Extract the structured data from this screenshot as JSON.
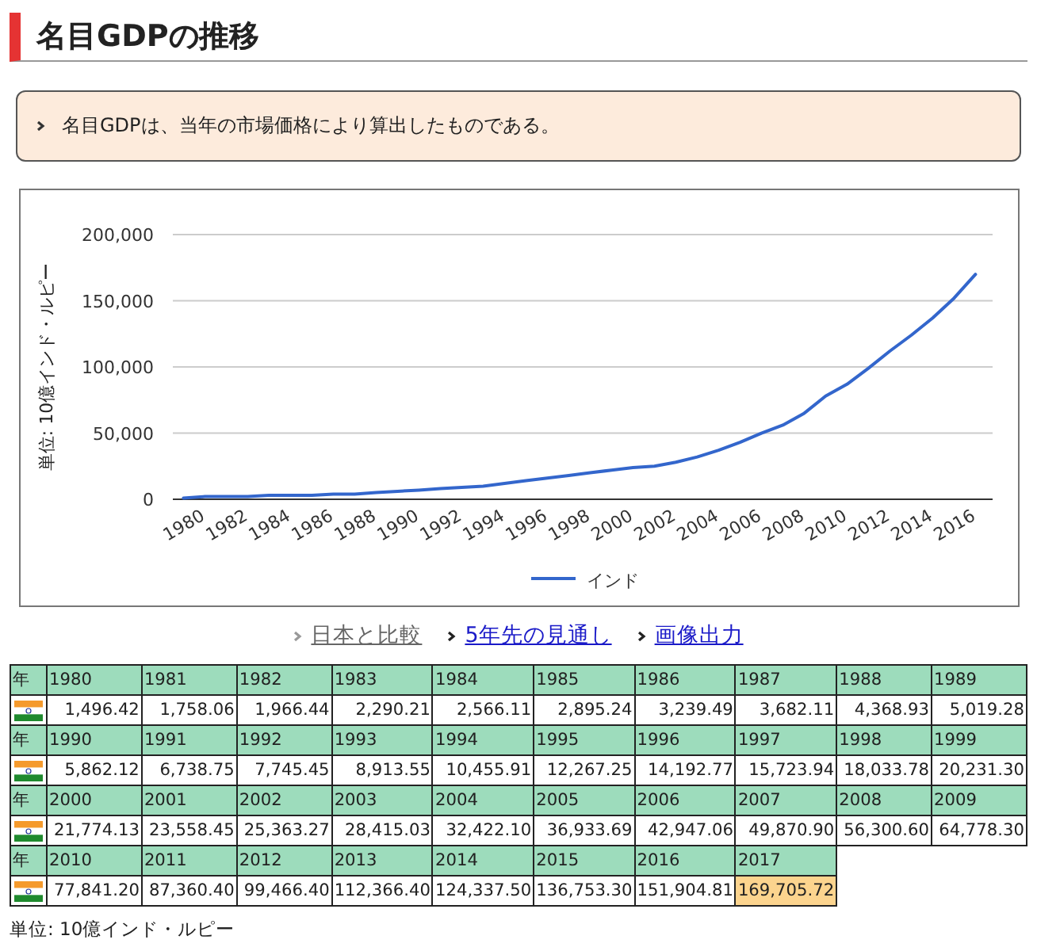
{
  "heading": "名目GDPの推移",
  "note": "名目GDPは、当年の市場価格により算出したものである。",
  "chart": {
    "chart_data": {
      "type": "line",
      "ylabel": "単位: 10億インド・ルピー",
      "x": [
        1980,
        1981,
        1982,
        1983,
        1984,
        1985,
        1986,
        1987,
        1988,
        1989,
        1990,
        1991,
        1992,
        1993,
        1994,
        1995,
        1996,
        1997,
        1998,
        1999,
        2000,
        2001,
        2002,
        2003,
        2004,
        2005,
        2006,
        2007,
        2008,
        2009,
        2010,
        2011,
        2012,
        2013,
        2014,
        2015,
        2016,
        2017
      ],
      "series": [
        {
          "name": "インド",
          "color": "#3366cc",
          "values": [
            1000,
            2000,
            2000,
            2000,
            3000,
            3000,
            3000,
            4000,
            4000,
            5000,
            6000,
            7000,
            8000,
            9000,
            10000,
            12000,
            14000,
            16000,
            18000,
            20000,
            22000,
            24000,
            25000,
            28000,
            32000,
            37000,
            43000,
            50000,
            56000,
            65000,
            78000,
            87000,
            99000,
            112000,
            124000,
            137000,
            152000,
            170000
          ]
        }
      ],
      "xlim": [
        1979.5,
        2017.8
      ],
      "ylim": [
        0,
        200000
      ],
      "grid": true,
      "yticks": [
        {
          "value": 0,
          "label": "0"
        },
        {
          "value": 50000,
          "label": "50,000"
        },
        {
          "value": 100000,
          "label": "100,000"
        },
        {
          "value": 150000,
          "label": "150,000"
        },
        {
          "value": 200000,
          "label": "200,000"
        }
      ],
      "xticks": [
        1980,
        1982,
        1984,
        1986,
        1988,
        1990,
        1992,
        1994,
        1996,
        1998,
        2000,
        2002,
        2004,
        2006,
        2008,
        2010,
        2012,
        2014,
        2016
      ]
    }
  },
  "links": [
    {
      "label": "日本と比較",
      "selected": true
    },
    {
      "label": "5年先の見通し",
      "selected": false
    },
    {
      "label": "画像出力",
      "selected": false
    }
  ],
  "table": {
    "blocks": [
      {
        "year_label": "年",
        "years": [
          "1980",
          "1981",
          "1982",
          "1983",
          "1984",
          "1985",
          "1986",
          "1987",
          "1988",
          "1989"
        ],
        "values": [
          {
            "text": "1,496.42",
            "estimate": false
          },
          {
            "text": "1,758.06",
            "estimate": false
          },
          {
            "text": "1,966.44",
            "estimate": false
          },
          {
            "text": "2,290.21",
            "estimate": false
          },
          {
            "text": "2,566.11",
            "estimate": false
          },
          {
            "text": "2,895.24",
            "estimate": false
          },
          {
            "text": "3,239.49",
            "estimate": false
          },
          {
            "text": "3,682.11",
            "estimate": false
          },
          {
            "text": "4,368.93",
            "estimate": false
          },
          {
            "text": "5,019.28",
            "estimate": false
          }
        ]
      },
      {
        "year_label": "年",
        "years": [
          "1990",
          "1991",
          "1992",
          "1993",
          "1994",
          "1995",
          "1996",
          "1997",
          "1998",
          "1999"
        ],
        "values": [
          {
            "text": "5,862.12",
            "estimate": false
          },
          {
            "text": "6,738.75",
            "estimate": false
          },
          {
            "text": "7,745.45",
            "estimate": false
          },
          {
            "text": "8,913.55",
            "estimate": false
          },
          {
            "text": "10,455.91",
            "estimate": false
          },
          {
            "text": "12,267.25",
            "estimate": false
          },
          {
            "text": "14,192.77",
            "estimate": false
          },
          {
            "text": "15,723.94",
            "estimate": false
          },
          {
            "text": "18,033.78",
            "estimate": false
          },
          {
            "text": "20,231.30",
            "estimate": false
          }
        ]
      },
      {
        "year_label": "年",
        "years": [
          "2000",
          "2001",
          "2002",
          "2003",
          "2004",
          "2005",
          "2006",
          "2007",
          "2008",
          "2009"
        ],
        "values": [
          {
            "text": "21,774.13",
            "estimate": false
          },
          {
            "text": "23,558.45",
            "estimate": false
          },
          {
            "text": "25,363.27",
            "estimate": false
          },
          {
            "text": "28,415.03",
            "estimate": false
          },
          {
            "text": "32,422.10",
            "estimate": false
          },
          {
            "text": "36,933.69",
            "estimate": false
          },
          {
            "text": "42,947.06",
            "estimate": false
          },
          {
            "text": "49,870.90",
            "estimate": false
          },
          {
            "text": "56,300.60",
            "estimate": false
          },
          {
            "text": "64,778.30",
            "estimate": false
          }
        ]
      },
      {
        "year_label": "年",
        "years": [
          "2010",
          "2011",
          "2012",
          "2013",
          "2014",
          "2015",
          "2016",
          "2017"
        ],
        "values": [
          {
            "text": "77,841.20",
            "estimate": false
          },
          {
            "text": "87,360.40",
            "estimate": false
          },
          {
            "text": "99,466.40",
            "estimate": false
          },
          {
            "text": "112,366.40",
            "estimate": false
          },
          {
            "text": "124,337.50",
            "estimate": false
          },
          {
            "text": "136,753.30",
            "estimate": false
          },
          {
            "text": "151,904.81",
            "estimate": false
          },
          {
            "text": "169,705.72",
            "estimate": true
          }
        ]
      }
    ]
  },
  "unit_note": "単位: 10億インド・ルピー"
}
